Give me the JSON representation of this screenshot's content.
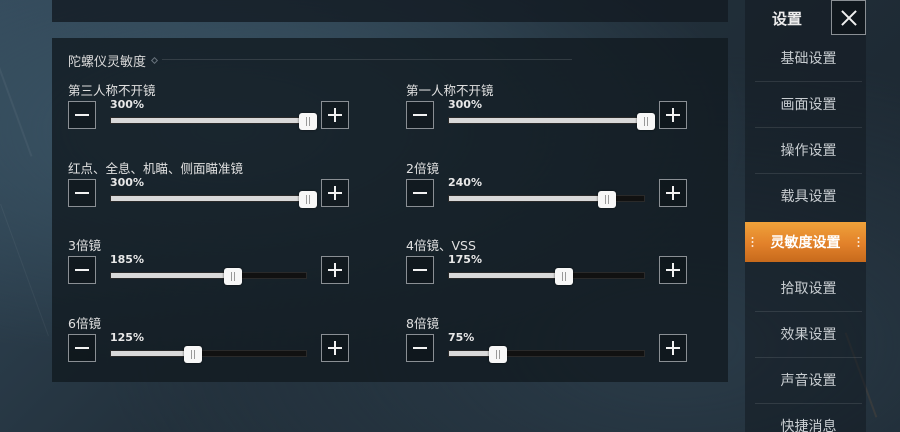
{
  "sidebar": {
    "title": "设置",
    "items": [
      {
        "label": "基础设置",
        "active": false
      },
      {
        "label": "画面设置",
        "active": false
      },
      {
        "label": "操作设置",
        "active": false
      },
      {
        "label": "载具设置",
        "active": false
      },
      {
        "label": "灵敏度设置",
        "active": true
      },
      {
        "label": "拾取设置",
        "active": false
      },
      {
        "label": "效果设置",
        "active": false
      },
      {
        "label": "声音设置",
        "active": false
      },
      {
        "label": "快捷消息",
        "active": false
      }
    ]
  },
  "section": {
    "title": "陀螺仪灵敏度"
  },
  "settings": [
    {
      "label": "第三人称不开镜",
      "value": "300%",
      "fraction": 1.0
    },
    {
      "label": "第一人称不开镜",
      "value": "300%",
      "fraction": 1.0
    },
    {
      "label": "红点、全息、机瞄、侧面瞄准镜",
      "value": "300%",
      "fraction": 1.0
    },
    {
      "label": "2倍镜",
      "value": "240%",
      "fraction": 0.8
    },
    {
      "label": "3倍镜",
      "value": "185%",
      "fraction": 0.617
    },
    {
      "label": "4倍镜、VSS",
      "value": "175%",
      "fraction": 0.583
    },
    {
      "label": "6倍镜",
      "value": "125%",
      "fraction": 0.417
    },
    {
      "label": "8倍镜",
      "value": "75%",
      "fraction": 0.25
    }
  ]
}
